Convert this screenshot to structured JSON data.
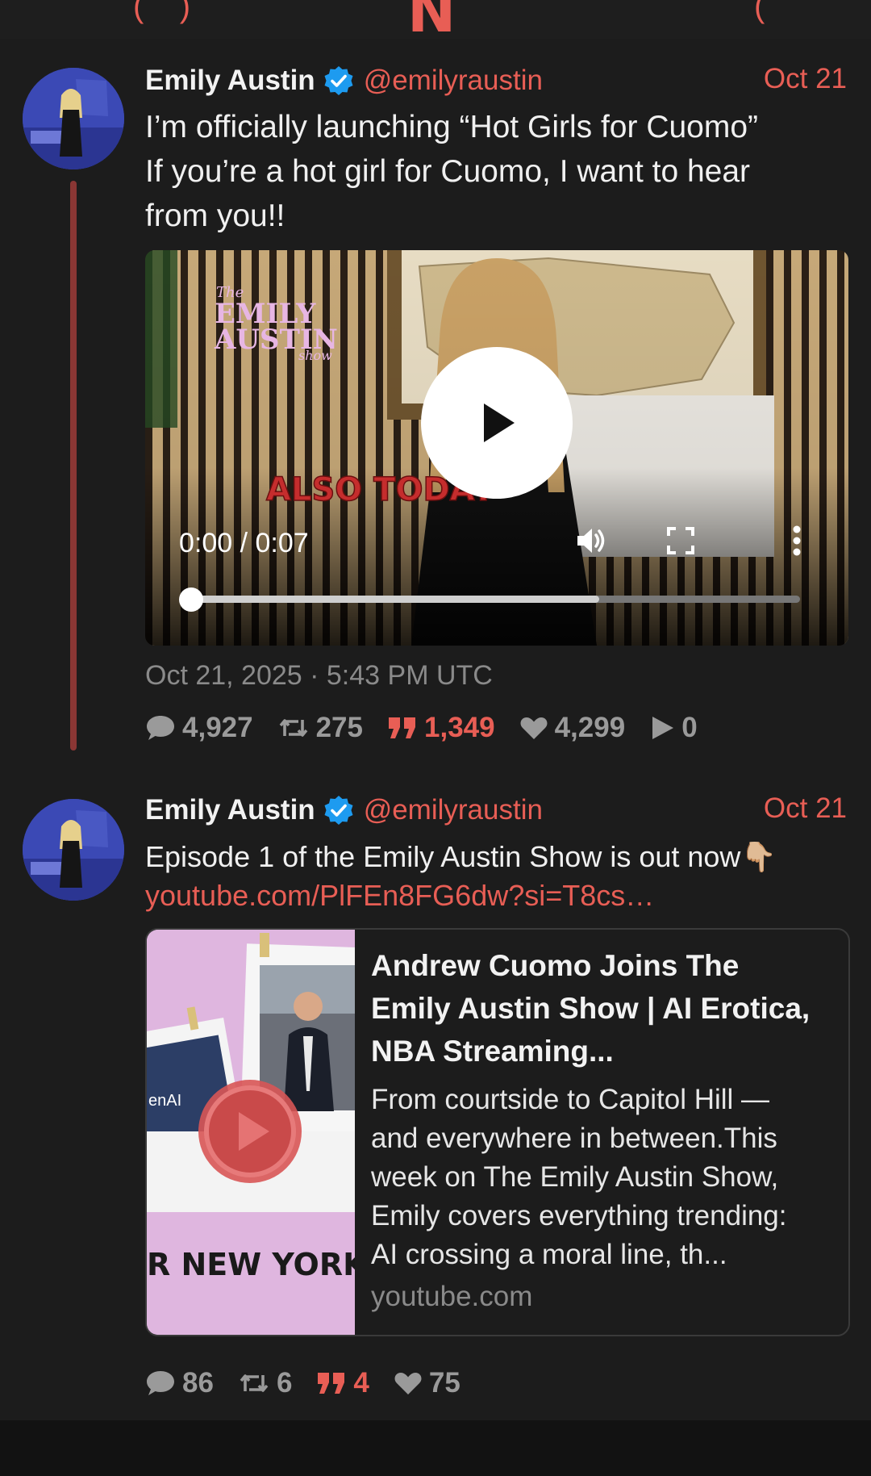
{
  "colors": {
    "accent": "#e85e55",
    "background": "#1c1c1c",
    "muted": "#8a8a8a",
    "verified": "#1d9bf0"
  },
  "tweets": [
    {
      "author_name": "Emily Austin",
      "handle": "@emilyraustin",
      "date": "Oct 21",
      "text_lines": [
        "I’m officially launching “Hot Girls for Cuomo”",
        "If you’re a hot girl for Cuomo, I want to hear",
        "from you!!"
      ],
      "video": {
        "overlay_logo_top": "The",
        "overlay_logo_mid1": "EMILY",
        "overlay_logo_mid2": "AUSTIN",
        "overlay_logo_bottom": "show",
        "banner": "ALSO TODAY",
        "time": "0:00 / 0:07",
        "buffered_fraction": 0.67,
        "played_fraction": 0.0
      },
      "timestamp": "Oct 21, 2025 · 5:43 PM UTC",
      "stats": {
        "replies": "4,927",
        "retweets": "275",
        "quotes": "1,349",
        "likes": "4,299",
        "views": "0"
      }
    },
    {
      "author_name": "Emily Austin",
      "handle": "@emilyraustin",
      "date": "Oct 21",
      "text": "Episode 1 of the Emily Austin Show is out now👇🏼",
      "link": "youtube.com/PlFEn8FG6dw?si=T8cs…",
      "card": {
        "title_lines": [
          "Andrew Cuomo Joins The",
          "Emily Austin Show | AI Erotica,",
          "NBA Streaming..."
        ],
        "desc_lines": [
          "From courtside to Capitol Hill —",
          "and everywhere in between.This",
          "week on The Emily Austin Show,",
          "Emily covers everything trending:",
          "AI crossing a moral line, th..."
        ],
        "domain": "youtube.com",
        "thumb_text": "R NEW YORK",
        "thumb_small_text": "enAI"
      },
      "stats": {
        "replies": "86",
        "retweets": "6",
        "quotes": "4",
        "likes": "75"
      }
    }
  ]
}
